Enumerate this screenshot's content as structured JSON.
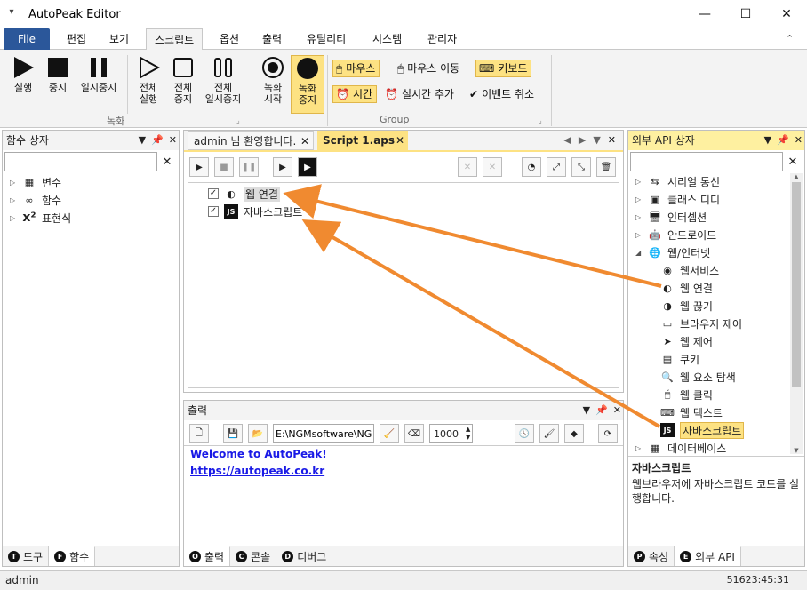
{
  "app": {
    "title": "AutoPeak Editor"
  },
  "window_controls": {
    "minimize": "—",
    "maximize": "☐",
    "close": "✕"
  },
  "menu": {
    "file": "File",
    "tabs": [
      "편집",
      "보기",
      "스크립트",
      "옵션",
      "출력",
      "유틸리티",
      "시스템",
      "관리자"
    ],
    "active": "스크립트"
  },
  "ribbon": {
    "record_group": {
      "buttons": [
        {
          "label": "실행"
        },
        {
          "label": "중지"
        },
        {
          "label": "일시중지"
        },
        {
          "label": "전체\n실행"
        },
        {
          "label": "전체\n중지"
        },
        {
          "label": "전체\n일시중지"
        },
        {
          "label": "녹화\n시작"
        },
        {
          "label": "녹화\n중지"
        }
      ],
      "label": "녹화"
    },
    "group": {
      "label": "Group",
      "items": [
        "마우스",
        "마우스 이동",
        "키보드",
        "시간",
        "실시간 추가",
        "이벤트 취소"
      ]
    }
  },
  "left_panel": {
    "title": "함수 상자",
    "search_placeholder": "",
    "tree": [
      "변수",
      "함수",
      "표현식"
    ],
    "tabs": [
      "도구",
      "함수"
    ]
  },
  "editor": {
    "tabs": [
      "admin 님 환영합니다.",
      "Script 1.aps"
    ],
    "lines": [
      "웹 연결",
      "자바스크립트"
    ]
  },
  "output": {
    "title": "출력",
    "path": "E:\\NGMsoftware\\NG",
    "number": "1000",
    "welcome": "Welcome to AutoPeak!",
    "link": "https://autopeak.co.kr",
    "tabs": [
      "출력",
      "콘솔",
      "디버그"
    ]
  },
  "right_panel": {
    "title": "외부 API 상자",
    "tree": {
      "collapsed": [
        "시리얼 통신",
        "클래스 디디",
        "인터셉션",
        "안드로이드"
      ],
      "expanded": "웹/인터넷",
      "children": [
        "웹서비스",
        "웹 연결",
        "웹 끊기",
        "브라우저 제어",
        "웹 제어",
        "쿠키",
        "웹 요소 탐색",
        "웹 클릭",
        "웹 텍스트",
        "자바스크립트"
      ],
      "after": [
        "데이터베이스"
      ]
    },
    "desc_title": "자바스크립트",
    "desc_text": "웹브라우저에 자바스크립트 코드를 실행합니다.",
    "tabs": [
      "속성",
      "외부 API"
    ]
  },
  "status": {
    "user": "admin",
    "time": "51623:45:31"
  },
  "colors": {
    "accent": "#2b579a",
    "highlight": "#fde283",
    "arrow": "#f08a30",
    "link": "#1a1ae6"
  }
}
